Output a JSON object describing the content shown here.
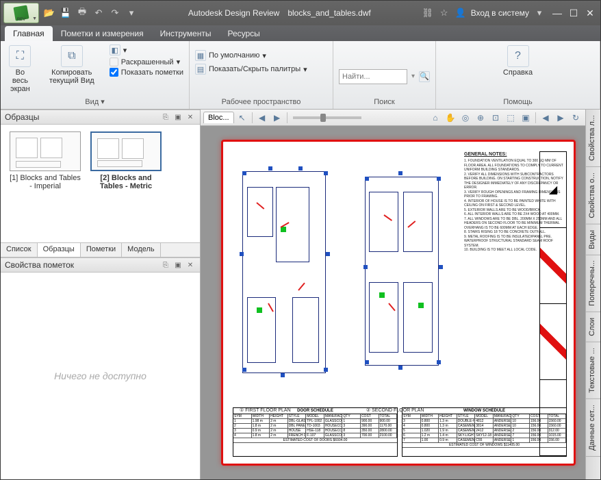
{
  "title": {
    "app": "Autodesk Design Review",
    "file": "blocks_and_tables.dwf"
  },
  "appmenu_rev": "REV",
  "signin": "Вход в систему",
  "ribbon_tabs": [
    "Главная",
    "Пометки и измерения",
    "Инструменты",
    "Ресурсы"
  ],
  "ribbon": {
    "fullscreen": "Во весь экран",
    "copy_view": "Копировать текущий Вид",
    "view_group": "Вид",
    "colored": "Раскрашенный",
    "show_markups": "Показать пометки",
    "default": "По умолчанию",
    "palettes": "Показать/Скрыть палитры",
    "workspace_group": "Рабочее пространство",
    "search_placeholder": "Найти...",
    "search_group": "Поиск",
    "help": "Справка",
    "help_group": "Помощь"
  },
  "panels": {
    "thumbs_title": "Образцы",
    "thumb1": "[1] Blocks and Tables - Imperial",
    "thumb2": "[2] Blocks and Tables - Metric",
    "ltabs": [
      "Список",
      "Образцы",
      "Пометки",
      "Модель"
    ],
    "props_title": "Свойства пометок",
    "props_empty": "Ничего не доступно"
  },
  "view_tab": "Bloc...",
  "right_tabs": [
    "Свойства л...",
    "Свойства о...",
    "Виды",
    "Поперечны...",
    "Слои",
    "Текстовые ...",
    "Данные сет..."
  ],
  "sheet": {
    "notes_title": "GENERAL NOTES:",
    "notes_lines": [
      "1. FOUNDATION VENTILATION EQUAL TO 300 SQ MM OF FLOOR AREA. ALL FOUNDATIONS TO COMPLY TO CURRENT UNIFORM BUILDING STANDARDS.",
      "2. VERIFY ALL DIMENSIONS WITH SUBCONTRACTORS BEFORE BUILDING. ON STARTING CONSTRUCTION, NOTIFY THE DESIGNER IMMEDIATELY OF ANY DISCREPANCY OR ERROR.",
      "3. VERIFY ROUGH OPENINGS AND FRAMING DIMENSIONS PRIOR TO FRAMING.",
      "4. INTERIOR OF HOUSE IS TO BE PAINTED WHITE WITH CEILING ON FIRST & SECOND LEVEL.",
      "5. EXTERIOR WALLS ARE TO BE WOOD/BRICK.",
      "6. ALL INTERIOR WALLS ARE TO BE 2X4 WOOD AT 400MM.",
      "7. ALL WINDOWS ARE TO BE DBL. 200MM X 250MM AND ALL HEADERS ON SECOND FLOOR TO BE MINIMUM THERMAL OVERHANG IS TO BE 600MM AT EACH EDGE.",
      "8. STAIRS RISING 18 TO BE CONCRETE OUTFALL.",
      "9. METAL ROOFING IS TO BE INSULATED/PANEL PRE. WATERPROOF STRUCTURAL STANDARD SEAM ROOF SYSTEM.",
      "10. BUILDING IS TO MEET ALL LOCAL CODE."
    ],
    "plan1": "FIRST FLOOR PLAN",
    "plan2": "SECOND FLOOR PLAN",
    "door_sched": "DOOR SCHEDULE",
    "window_sched": "WINDOW SCHEDULE",
    "sched_cols": [
      "SYM",
      "WIDTH",
      "HEIGHT",
      "STYLE",
      "MODEL",
      "MANUFACTURER",
      "QTY",
      "COST",
      "TOTAL"
    ],
    "door_rows": [
      [
        "1",
        "1.98 m",
        "2 m",
        "DBL-GLASS",
        "TPL-1002",
        "GLASSCO",
        "1",
        "900.00",
        "900.00"
      ],
      [
        "2",
        "1.8 m",
        "2 m",
        "DBL PANEL",
        "TD-1003",
        "HOUSECO",
        "3",
        "390.00",
        "1170.00"
      ],
      [
        "3",
        "0.9 m",
        "2 m",
        "HOUSE",
        "HSE-118",
        "HOUSECO",
        "8",
        "350.00",
        "2800.00"
      ],
      [
        "4",
        "1.8 m",
        "2 m",
        "FRENCH DOORS",
        "F-107",
        "GLASSCO",
        "3",
        "700.00",
        "2100.00"
      ]
    ],
    "door_total": "ESTIMATED COST OF DOORS $6934.00",
    "window_rows": [
      [
        "3",
        "0.800",
        "1.3 m",
        "DOUBLE-HUNG",
        "4812",
        "ANDERSEN",
        "10",
        "156.00",
        "1560.00"
      ],
      [
        "4",
        "0.800",
        "1.3 m",
        "CASEMENT",
        "3814",
        "ANDERSEN",
        "10",
        "156.00",
        "1560.00"
      ],
      [
        "5",
        "1.020",
        "1.9 m",
        "CASEMENT",
        "2412",
        "ANDERSEN",
        "2",
        "156.00",
        "312.00"
      ],
      [
        "6",
        "1.2 m",
        "1.4 m",
        "SKY-LIGHT",
        "SKY12-18",
        "ANDERSEN",
        "7",
        "156.00",
        "1015.00"
      ],
      [
        "7",
        "1.00",
        "0.9 m",
        "CASEMENT",
        "C55",
        "ANDERSEN",
        "1",
        "156.00",
        "156.00"
      ]
    ],
    "window_total": "ESTIMATED COST OF WINDOWS $11405.00"
  }
}
